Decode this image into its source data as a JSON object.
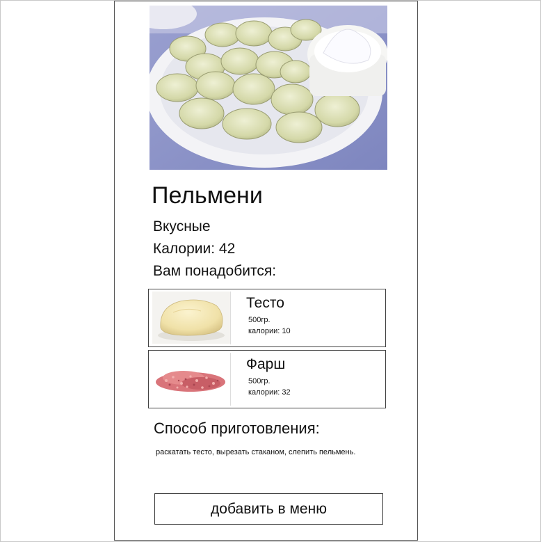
{
  "dish": {
    "title": "Пельмени",
    "subtitle": "Вкусные",
    "calories": "Калории: 42",
    "need_label": "Вам понадобится:",
    "hero_image_icon": "dumplings-photo"
  },
  "ingredients": [
    {
      "name": "Тесто",
      "qty": "500гр.",
      "kcal": "калории: 10",
      "image_icon": "dough-photo"
    },
    {
      "name": "Фарш",
      "qty": "500гр.",
      "kcal": "калории:  32",
      "image_icon": "minced-meat-photo"
    }
  ],
  "method": {
    "title": "Способ приготовления:",
    "text": "раскатать тесто, вырезать стаканом, слепить пельмень."
  },
  "actions": {
    "add_label": "добавить в меню"
  },
  "colors": {
    "hero_bg": "#8e95c8",
    "card_border": "#444444"
  }
}
